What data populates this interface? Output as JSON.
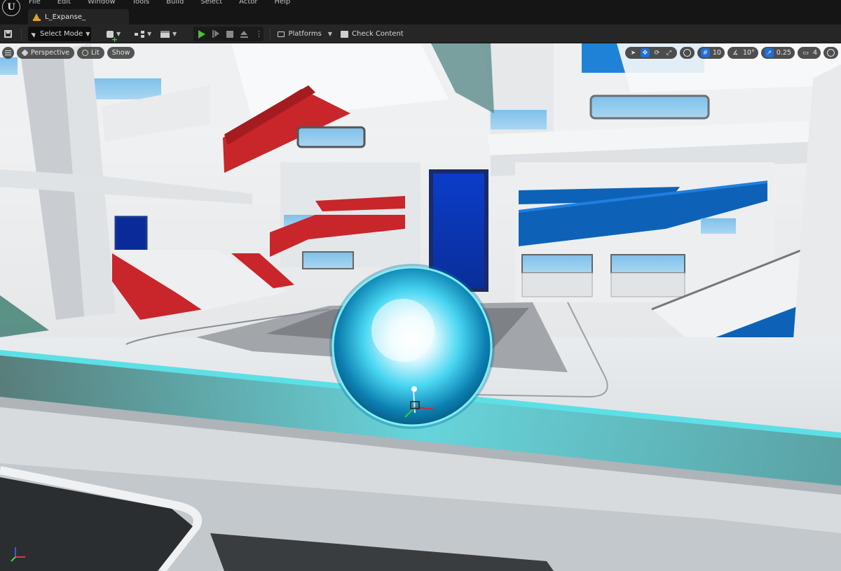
{
  "app": {
    "logo": "unreal-engine-logo"
  },
  "menu": [
    "File",
    "Edit",
    "Window",
    "Tools",
    "Build",
    "Select",
    "Actor",
    "Help"
  ],
  "tab": {
    "label": "L_Expanse_"
  },
  "toolbar": {
    "select_mode": "Select Mode",
    "platforms": "Platforms",
    "check_content": "Check Content"
  },
  "viewport": {
    "view_mode": "Perspective",
    "lighting": "Lit",
    "show": "Show",
    "grid_snap": "10",
    "rotation_snap": "10°",
    "scale_snap": "0.25",
    "camera_speed": "4"
  },
  "colors": {
    "accent_blue": "#1f6fd6",
    "play_green": "#4fbf3a",
    "orb_cyan": "#35d6ff",
    "scene_red": "#c8262a",
    "scene_blue": "#0d62b8"
  }
}
